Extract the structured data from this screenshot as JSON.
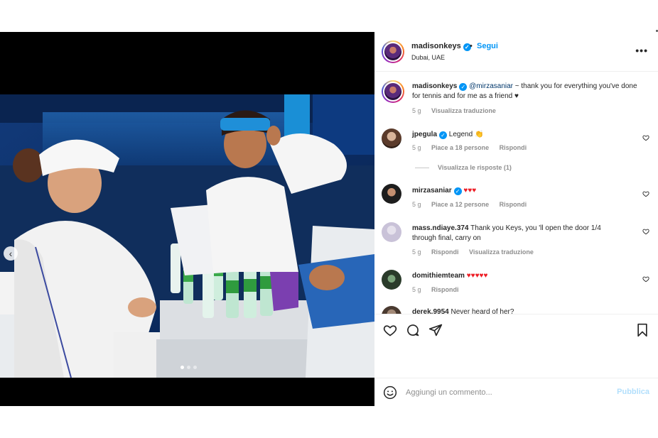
{
  "post": {
    "username": "madisonkeys",
    "follow_label": "Segui",
    "separator": "•",
    "location": "Dubai, UAE",
    "more_label": "•••"
  },
  "caption": {
    "username": "madisonkeys",
    "mention": "@mirzasaniar",
    "text": " ~ thank you for everything you've done for tennis and for me as a friend ♥",
    "time": "5 g",
    "translate_label": "Visualizza traduzione"
  },
  "comments": [
    {
      "username": "jpegula",
      "verified": true,
      "text": "Legend 👏",
      "time": "5 g",
      "likes": "Piace a 18 persone",
      "reply_label": "Rispondi",
      "view_replies": "Visualizza le risposte (1)"
    },
    {
      "username": "mirzasaniar",
      "verified": true,
      "text": "♥♥♥",
      "time": "5 g",
      "likes": "Piace a 12 persone",
      "reply_label": "Rispondi"
    },
    {
      "username": "mass.ndiaye.374",
      "verified": false,
      "text": "Thank you Keys, you 'll open the door 1/4 through final, carry on",
      "time": "5 g",
      "reply_label": "Rispondi",
      "translate_label": "Visualizza traduzione"
    },
    {
      "username": "domithiemteam",
      "verified": false,
      "text": "♥♥♥♥♥",
      "time": "5 g",
      "reply_label": "Rispondi"
    },
    {
      "username": "derek.9954",
      "verified": false,
      "text": "Never heard of her?"
    }
  ],
  "composer": {
    "placeholder": "Aggiungi un commento...",
    "publish_label": "Pubblica"
  },
  "carousel": {
    "prev_label": "‹",
    "slide_count": 3,
    "active_slide": 1
  },
  "colors": {
    "link_blue": "#0095f6",
    "mention_blue": "#00376b",
    "meta_gray": "#8e8e8e",
    "publish_disabled": "#b2dffc",
    "heart_red": "#ed1c24"
  }
}
